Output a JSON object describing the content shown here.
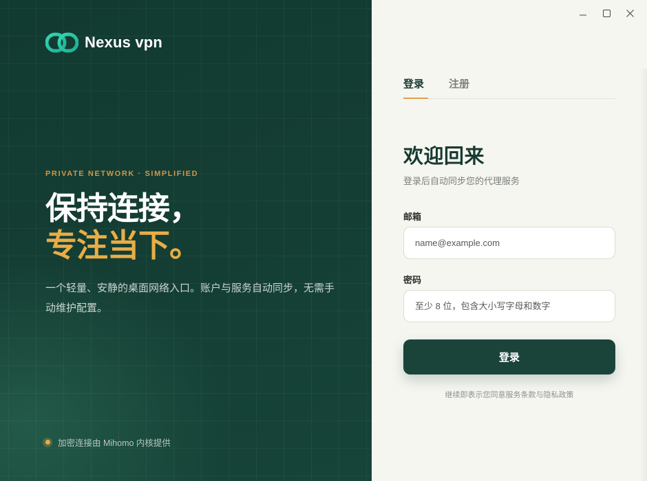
{
  "brand": {
    "name": "Nexus vpn",
    "icon": "chain-link-icon",
    "icon_color": "#2cc9a8"
  },
  "hero": {
    "tagline": "PRIVATE NETWORK · SIMPLIFIED",
    "headline_line1": "保持连接，",
    "headline_line2": "专注当下。",
    "description": "一个轻量、安静的桌面网络入口。账户与服务自动同步，无需手动维护配置。",
    "footer_note": "加密连接由 Mihomo 内核提供"
  },
  "window_controls": {
    "minimize": "—",
    "maximize": "☐",
    "close": "✕"
  },
  "tabs": [
    {
      "label": "登录",
      "active": true
    },
    {
      "label": "注册",
      "active": false
    }
  ],
  "form": {
    "title": "欢迎回来",
    "subtitle": "登录后自动同步您的代理服务",
    "email_label": "邮箱",
    "email_placeholder": "name@example.com",
    "password_label": "密码",
    "password_placeholder": "至少 8 位，包含大小写字母和数字",
    "submit_label": "登录",
    "terms": "继续即表示您同意服务条款与隐私政策"
  },
  "colors": {
    "left_bg": "#143d33",
    "accent": "#e9ad46",
    "primary_button": "#1a443a",
    "right_bg": "#f6f6f1"
  }
}
